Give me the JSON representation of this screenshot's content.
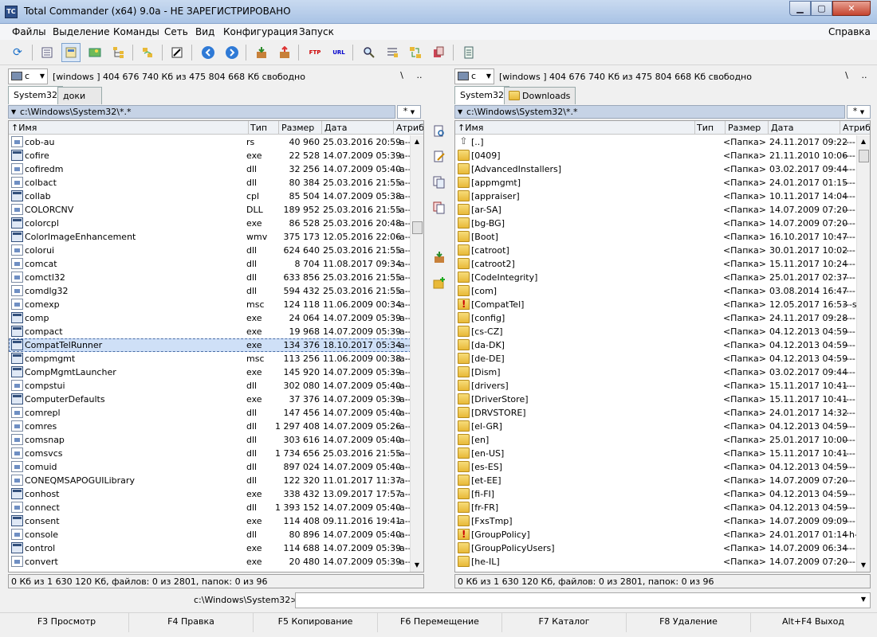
{
  "window": {
    "title": "Total Commander (x64) 9.0a - НЕ ЗАРЕГИСТРИРОВАНО",
    "min": "▁",
    "max": "▢",
    "close": "✕"
  },
  "menu": [
    "Файлы",
    "Выделение",
    "Команды",
    "Сеть",
    "Вид",
    "Конфигурация",
    "Запуск",
    "Справка"
  ],
  "toolbar_icons": [
    "refresh-icon",
    "brief-view-icon",
    "full-view-icon",
    "thumbnails-icon",
    "tree-view-icon",
    "invert-selection-icon",
    "quick-view-icon",
    "back-icon",
    "forward-icon",
    "pack-icon",
    "unpack-icon",
    "ftp-connect-icon",
    "url-connect-icon",
    "search-icon",
    "multi-rename-icon",
    "sync-dirs-icon",
    "copy-icon",
    "notepad-icon"
  ],
  "left": {
    "drive": "c",
    "drive_info": "[windows ]  404 676 740 Кб из 475 804 668 Кб свободно",
    "root_btn": "\\",
    "up_btn": "..",
    "tabs": [
      "System32",
      "доки"
    ],
    "path": "c:\\Windows\\System32\\*.*",
    "filter": "*",
    "columns": {
      "name": "Имя",
      "type": "Тип",
      "size": "Размер",
      "date": "Дата",
      "attr": "Атриб"
    },
    "files": [
      {
        "icon": "file",
        "name": "cob-au",
        "type": "rs",
        "size": "40 960",
        "date": "25.03.2016 20:59",
        "attr": "-a--"
      },
      {
        "icon": "exe",
        "name": "cofire",
        "type": "exe",
        "size": "22 528",
        "date": "14.07.2009 05:39",
        "attr": "-a--"
      },
      {
        "icon": "file",
        "name": "cofiredm",
        "type": "dll",
        "size": "32 256",
        "date": "14.07.2009 05:40",
        "attr": "-a--"
      },
      {
        "icon": "file",
        "name": "colbact",
        "type": "dll",
        "size": "80 384",
        "date": "25.03.2016 21:55",
        "attr": "-a--"
      },
      {
        "icon": "exe",
        "name": "collab",
        "type": "cpl",
        "size": "85 504",
        "date": "14.07.2009 05:38",
        "attr": "-a--"
      },
      {
        "icon": "file",
        "name": "COLORCNV",
        "type": "DLL",
        "size": "189 952",
        "date": "25.03.2016 21:55",
        "attr": "-a--"
      },
      {
        "icon": "exe",
        "name": "colorcpl",
        "type": "exe",
        "size": "86 528",
        "date": "25.03.2016 20:48",
        "attr": "-a--"
      },
      {
        "icon": "exe",
        "name": "ColorImageEnhancement",
        "type": "wmv",
        "size": "375 173",
        "date": "12.05.2016 22:06",
        "attr": "-a--"
      },
      {
        "icon": "file",
        "name": "colorui",
        "type": "dll",
        "size": "624 640",
        "date": "25.03.2016 21:55",
        "attr": "-a--"
      },
      {
        "icon": "file",
        "name": "comcat",
        "type": "dll",
        "size": "8 704",
        "date": "11.08.2017 09:34",
        "attr": "-a--"
      },
      {
        "icon": "file",
        "name": "comctl32",
        "type": "dll",
        "size": "633 856",
        "date": "25.03.2016 21:55",
        "attr": "-a--"
      },
      {
        "icon": "file",
        "name": "comdlg32",
        "type": "dll",
        "size": "594 432",
        "date": "25.03.2016 21:55",
        "attr": "-a--"
      },
      {
        "icon": "file",
        "name": "comexp",
        "type": "msc",
        "size": "124 118",
        "date": "11.06.2009 00:34",
        "attr": "-a--"
      },
      {
        "icon": "exe",
        "name": "comp",
        "type": "exe",
        "size": "24 064",
        "date": "14.07.2009 05:39",
        "attr": "-a--"
      },
      {
        "icon": "exe",
        "name": "compact",
        "type": "exe",
        "size": "19 968",
        "date": "14.07.2009 05:39",
        "attr": "-a--"
      },
      {
        "icon": "exe",
        "name": "CompatTelRunner",
        "type": "exe",
        "size": "134 376",
        "date": "18.10.2017 05:34",
        "attr": "-a--",
        "selected": true
      },
      {
        "icon": "exe",
        "name": "compmgmt",
        "type": "msc",
        "size": "113 256",
        "date": "11.06.2009 00:38",
        "attr": "-a--"
      },
      {
        "icon": "exe",
        "name": "CompMgmtLauncher",
        "type": "exe",
        "size": "145 920",
        "date": "14.07.2009 05:39",
        "attr": "-a--"
      },
      {
        "icon": "file",
        "name": "compstui",
        "type": "dll",
        "size": "302 080",
        "date": "14.07.2009 05:40",
        "attr": "-a--"
      },
      {
        "icon": "exe",
        "name": "ComputerDefaults",
        "type": "exe",
        "size": "37 376",
        "date": "14.07.2009 05:39",
        "attr": "-a--"
      },
      {
        "icon": "file",
        "name": "comrepl",
        "type": "dll",
        "size": "147 456",
        "date": "14.07.2009 05:40",
        "attr": "-a--"
      },
      {
        "icon": "file",
        "name": "comres",
        "type": "dll",
        "size": "1 297 408",
        "date": "14.07.2009 05:26",
        "attr": "-a--"
      },
      {
        "icon": "file",
        "name": "comsnap",
        "type": "dll",
        "size": "303 616",
        "date": "14.07.2009 05:40",
        "attr": "-a--"
      },
      {
        "icon": "file",
        "name": "comsvcs",
        "type": "dll",
        "size": "1 734 656",
        "date": "25.03.2016 21:55",
        "attr": "-a--"
      },
      {
        "icon": "file",
        "name": "comuid",
        "type": "dll",
        "size": "897 024",
        "date": "14.07.2009 05:40",
        "attr": "-a--"
      },
      {
        "icon": "file",
        "name": "CONEQMSAPOGUILibrary",
        "type": "dll",
        "size": "122 320",
        "date": "11.01.2017 11:37",
        "attr": "-a--"
      },
      {
        "icon": "exe",
        "name": "conhost",
        "type": "exe",
        "size": "338 432",
        "date": "13.09.2017 17:57",
        "attr": "-a--"
      },
      {
        "icon": "file",
        "name": "connect",
        "type": "dll",
        "size": "1 393 152",
        "date": "14.07.2009 05:40",
        "attr": "-a--"
      },
      {
        "icon": "exe",
        "name": "consent",
        "type": "exe",
        "size": "114 408",
        "date": "09.11.2016 19:41",
        "attr": "-a--"
      },
      {
        "icon": "file",
        "name": "console",
        "type": "dll",
        "size": "80 896",
        "date": "14.07.2009 05:40",
        "attr": "-a--"
      },
      {
        "icon": "exe",
        "name": "control",
        "type": "exe",
        "size": "114 688",
        "date": "14.07.2009 05:39",
        "attr": "-a--"
      },
      {
        "icon": "file",
        "name": "convert",
        "type": "exe",
        "size": "20 480",
        "date": "14.07.2009 05:39",
        "attr": "-a--"
      }
    ],
    "status": "0 Кб из 1 630 120 Кб, файлов: 0 из 2801, папок: 0 из 96"
  },
  "right": {
    "drive": "c",
    "drive_info": "[windows ]  404 676 740 Кб из 475 804 668 Кб свободно",
    "root_btn": "\\",
    "up_btn": "..",
    "tabs": [
      "System32",
      "Downloads"
    ],
    "path": "c:\\Windows\\System32\\*.*",
    "filter": "*",
    "columns": {
      "name": "Имя",
      "type": "Тип",
      "size": "Размер",
      "date": "Дата",
      "attr": "Атриб"
    },
    "files": [
      {
        "icon": "up",
        "name": "[..]",
        "size": "<Папка>",
        "date": "24.11.2017 09:22",
        "attr": "----"
      },
      {
        "icon": "folder",
        "name": "[0409]",
        "size": "<Папка>",
        "date": "21.11.2010 10:06",
        "attr": "----"
      },
      {
        "icon": "folder",
        "name": "[AdvancedInstallers]",
        "size": "<Папка>",
        "date": "03.02.2017 09:44",
        "attr": "----"
      },
      {
        "icon": "folder",
        "name": "[appmgmt]",
        "size": "<Папка>",
        "date": "24.01.2017 01:15",
        "attr": "----"
      },
      {
        "icon": "folder",
        "name": "[appraiser]",
        "size": "<Папка>",
        "date": "10.11.2017 14:04",
        "attr": "----"
      },
      {
        "icon": "folder",
        "name": "[ar-SA]",
        "size": "<Папка>",
        "date": "14.07.2009 07:20",
        "attr": "----"
      },
      {
        "icon": "folder",
        "name": "[bg-BG]",
        "size": "<Папка>",
        "date": "14.07.2009 07:20",
        "attr": "----"
      },
      {
        "icon": "folder",
        "name": "[Boot]",
        "size": "<Папка>",
        "date": "16.10.2017 10:47",
        "attr": "----"
      },
      {
        "icon": "folder",
        "name": "[catroot]",
        "size": "<Папка>",
        "date": "30.01.2017 10:02",
        "attr": "----"
      },
      {
        "icon": "folder",
        "name": "[catroot2]",
        "size": "<Папка>",
        "date": "15.11.2017 10:24",
        "attr": "----"
      },
      {
        "icon": "folder",
        "name": "[CodeIntegrity]",
        "size": "<Папка>",
        "date": "25.01.2017 02:37",
        "attr": "----"
      },
      {
        "icon": "folder",
        "name": "[com]",
        "size": "<Папка>",
        "date": "03.08.2014 16:47",
        "attr": "----"
      },
      {
        "icon": "warn",
        "name": "[CompatTel]",
        "size": "<Папка>",
        "date": "12.05.2017 16:53",
        "attr": "---s"
      },
      {
        "icon": "folder",
        "name": "[config]",
        "size": "<Папка>",
        "date": "24.11.2017 09:28",
        "attr": "----"
      },
      {
        "icon": "folder",
        "name": "[cs-CZ]",
        "size": "<Папка>",
        "date": "04.12.2013 04:59",
        "attr": "----"
      },
      {
        "icon": "folder",
        "name": "[da-DK]",
        "size": "<Папка>",
        "date": "04.12.2013 04:59",
        "attr": "----"
      },
      {
        "icon": "folder",
        "name": "[de-DE]",
        "size": "<Папка>",
        "date": "04.12.2013 04:59",
        "attr": "----"
      },
      {
        "icon": "folder",
        "name": "[Dism]",
        "size": "<Папка>",
        "date": "03.02.2017 09:44",
        "attr": "----"
      },
      {
        "icon": "folder",
        "name": "[drivers]",
        "size": "<Папка>",
        "date": "15.11.2017 10:41",
        "attr": "----"
      },
      {
        "icon": "folder",
        "name": "[DriverStore]",
        "size": "<Папка>",
        "date": "15.11.2017 10:41",
        "attr": "----"
      },
      {
        "icon": "folder",
        "name": "[DRVSTORE]",
        "size": "<Папка>",
        "date": "24.01.2017 14:32",
        "attr": "----"
      },
      {
        "icon": "folder",
        "name": "[el-GR]",
        "size": "<Папка>",
        "date": "04.12.2013 04:59",
        "attr": "----"
      },
      {
        "icon": "folder",
        "name": "[en]",
        "size": "<Папка>",
        "date": "25.01.2017 10:00",
        "attr": "----"
      },
      {
        "icon": "folder",
        "name": "[en-US]",
        "size": "<Папка>",
        "date": "15.11.2017 10:41",
        "attr": "----"
      },
      {
        "icon": "folder",
        "name": "[es-ES]",
        "size": "<Папка>",
        "date": "04.12.2013 04:59",
        "attr": "----"
      },
      {
        "icon": "folder",
        "name": "[et-EE]",
        "size": "<Папка>",
        "date": "14.07.2009 07:20",
        "attr": "----"
      },
      {
        "icon": "folder",
        "name": "[fi-FI]",
        "size": "<Папка>",
        "date": "04.12.2013 04:59",
        "attr": "----"
      },
      {
        "icon": "folder",
        "name": "[fr-FR]",
        "size": "<Папка>",
        "date": "04.12.2013 04:59",
        "attr": "----"
      },
      {
        "icon": "folder",
        "name": "[FxsTmp]",
        "size": "<Папка>",
        "date": "14.07.2009 09:09",
        "attr": "----"
      },
      {
        "icon": "warn",
        "name": "[GroupPolicy]",
        "size": "<Папка>",
        "date": "24.01.2017 01:14",
        "attr": "--h-"
      },
      {
        "icon": "folder",
        "name": "[GroupPolicyUsers]",
        "size": "<Папка>",
        "date": "14.07.2009 06:34",
        "attr": "----"
      },
      {
        "icon": "folder",
        "name": "[he-IL]",
        "size": "<Папка>",
        "date": "14.07.2009 07:20",
        "attr": "----"
      }
    ],
    "status": "0 Кб из 1 630 120 Кб, файлов: 0 из 2801, папок: 0 из 96"
  },
  "middle_icons": [
    "quick-view-icon",
    "edit-icon",
    "copy-icon",
    "move-icon",
    "unpack-icon",
    "new-folder-icon"
  ],
  "command": {
    "label": "c:\\Windows\\System32>",
    "value": ""
  },
  "fkeys": [
    "F3 Просмотр",
    "F4 Правка",
    "F5 Копирование",
    "F6 Перемещение",
    "F7 Каталог",
    "F8 Удаление",
    "Alt+F4 Выход"
  ]
}
